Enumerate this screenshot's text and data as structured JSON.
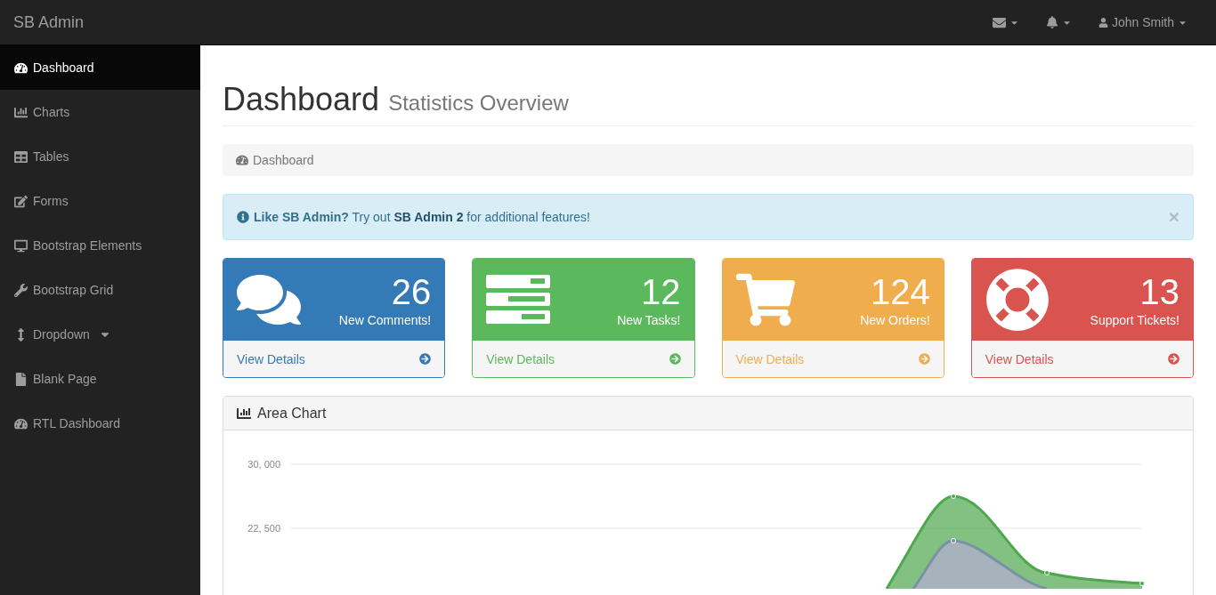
{
  "navbar": {
    "brand": "SB Admin",
    "user": "John Smith"
  },
  "sidebar": {
    "items": [
      {
        "label": "Dashboard",
        "kind": "link",
        "selected": true
      },
      {
        "label": "Charts",
        "kind": "link",
        "selected": false
      },
      {
        "label": "Tables",
        "kind": "link",
        "selected": false
      },
      {
        "label": "Forms",
        "kind": "link",
        "selected": false
      },
      {
        "label": "Bootstrap Elements",
        "kind": "link",
        "selected": false
      },
      {
        "label": "Bootstrap Grid",
        "kind": "link",
        "selected": false
      },
      {
        "label": "Dropdown",
        "kind": "dropdown",
        "selected": false
      },
      {
        "label": "Blank Page",
        "kind": "link",
        "selected": false
      },
      {
        "label": "RTL Dashboard",
        "kind": "link",
        "selected": false
      }
    ]
  },
  "header": {
    "title": "Dashboard",
    "subtitle": "Statistics Overview"
  },
  "breadcrumb": {
    "label": "Dashboard"
  },
  "alert": {
    "lead": "Like SB Admin?",
    "before": "Try out",
    "link": "SB Admin 2",
    "after": "for additional features!",
    "close": "×"
  },
  "cards": [
    {
      "kind": "comments",
      "color": "#337ab7",
      "count": "26",
      "label": "New Comments!",
      "link": "View Details"
    },
    {
      "kind": "tasks",
      "color": "#5cb85c",
      "count": "12",
      "label": "New Tasks!",
      "link": "View Details"
    },
    {
      "kind": "orders",
      "color": "#f0ad4e",
      "count": "124",
      "label": "New Orders!",
      "link": "View Details"
    },
    {
      "kind": "support",
      "color": "#d9534f",
      "count": "13",
      "label": "Support Tickets!",
      "link": "View Details"
    }
  ],
  "area_chart": {
    "title": "Area Chart",
    "axis_labels": [
      "30, 000",
      "22, 500"
    ]
  }
}
